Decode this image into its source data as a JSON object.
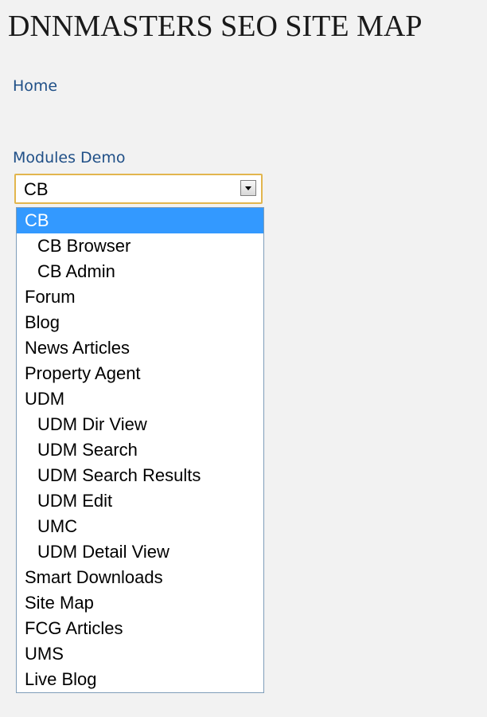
{
  "page": {
    "title": "DNNMASTERS SEO SITE MAP"
  },
  "nav": {
    "home_label": "Home",
    "section_label": "Modules Demo"
  },
  "select": {
    "value": "CB",
    "options": [
      {
        "label": "CB",
        "level": 0,
        "selected": true
      },
      {
        "label": "CB Browser",
        "level": 1
      },
      {
        "label": "CB Admin",
        "level": 1
      },
      {
        "label": "Forum",
        "level": 0
      },
      {
        "label": "Blog",
        "level": 0
      },
      {
        "label": "News Articles",
        "level": 0
      },
      {
        "label": "Property Agent",
        "level": 0
      },
      {
        "label": "UDM",
        "level": 0
      },
      {
        "label": "UDM Dir View",
        "level": 1
      },
      {
        "label": "UDM Search",
        "level": 1
      },
      {
        "label": "UDM Search Results",
        "level": 1
      },
      {
        "label": "UDM Edit",
        "level": 1
      },
      {
        "label": "UMC",
        "level": 1
      },
      {
        "label": "UDM Detail View",
        "level": 1
      },
      {
        "label": "Smart Downloads",
        "level": 0
      },
      {
        "label": "Site Map",
        "level": 0
      },
      {
        "label": "FCG Articles",
        "level": 0
      },
      {
        "label": "UMS",
        "level": 0
      },
      {
        "label": "Live Blog",
        "level": 0
      }
    ]
  },
  "colors": {
    "link": "#1f4f87",
    "highlight": "#3399ff",
    "focus_border": "#e2b64e",
    "background": "#f2f2f2"
  }
}
